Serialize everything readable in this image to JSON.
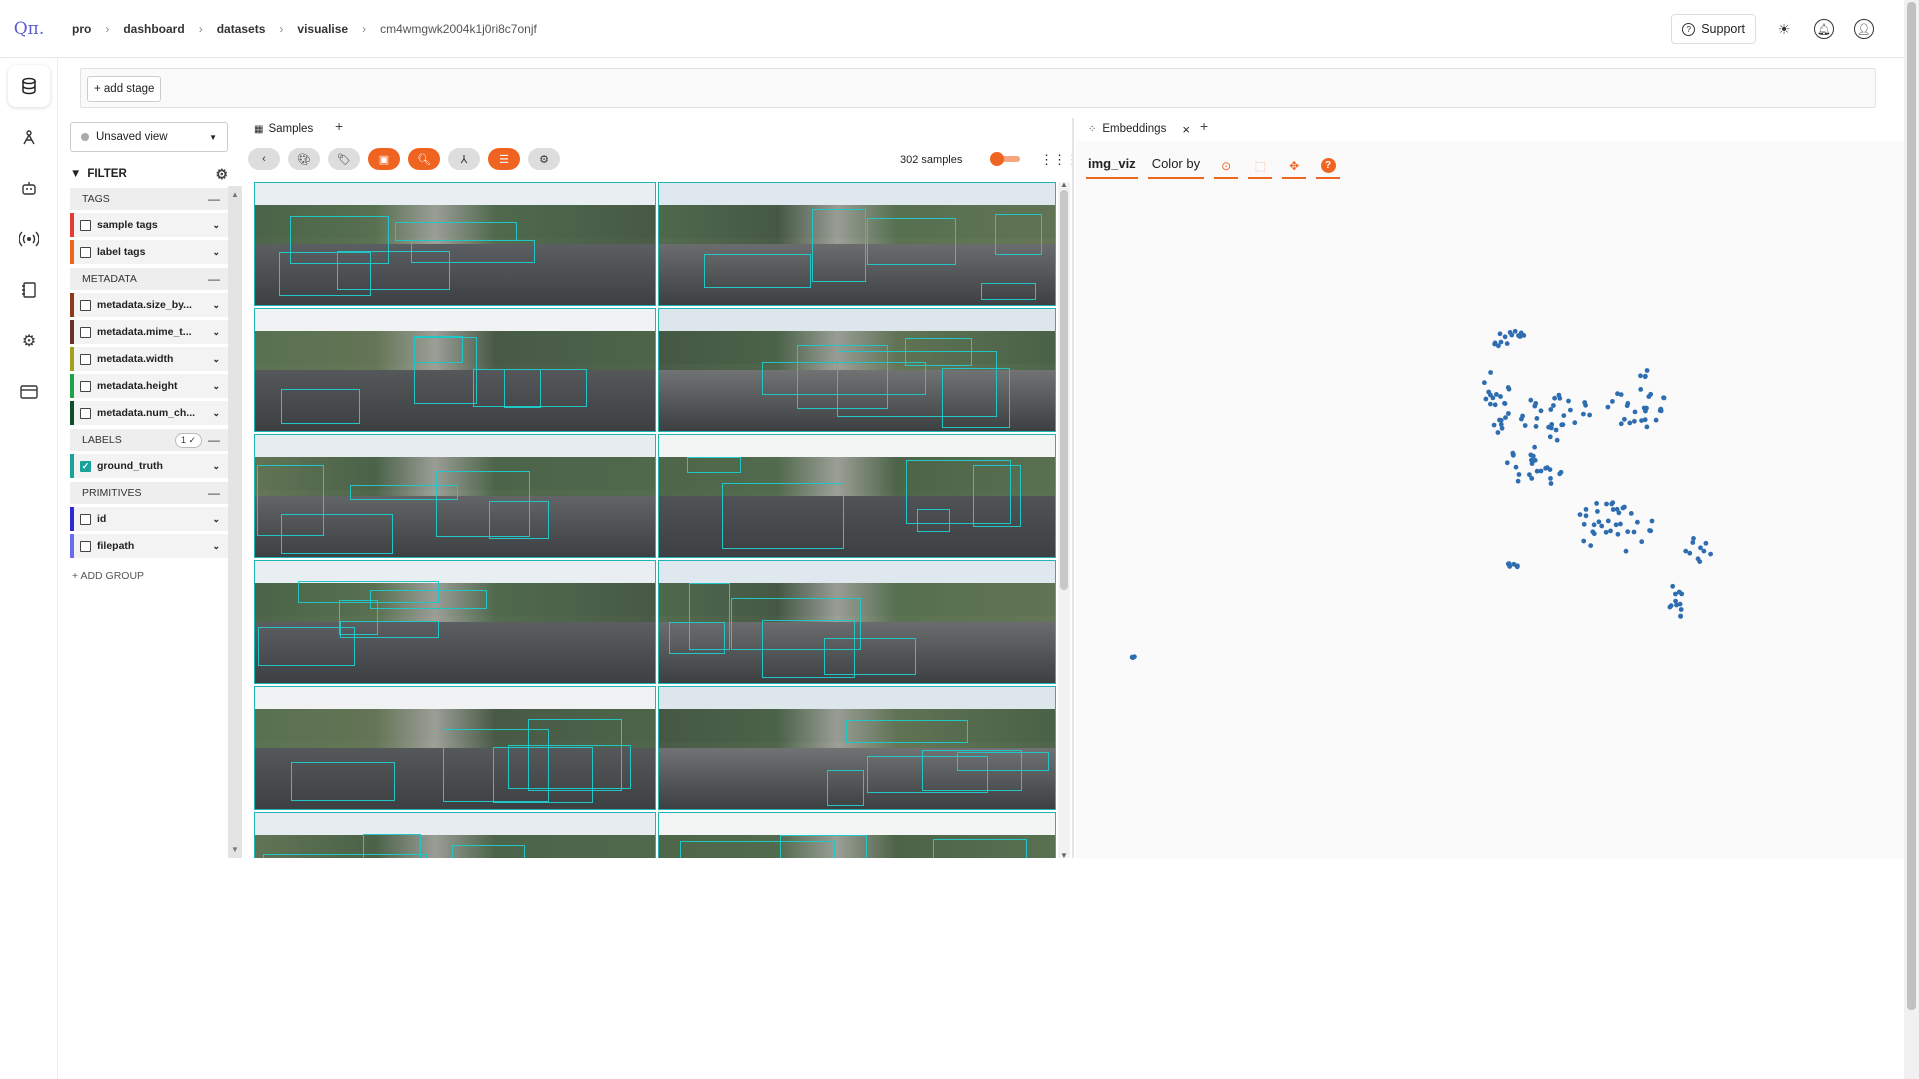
{
  "app": {
    "logo": "Qπ."
  },
  "breadcrumbs": [
    "pro",
    "dashboard",
    "datasets",
    "visualise",
    "cm4wmgwk2004k1j0ri8c7onjf"
  ],
  "topbar": {
    "support_label": "Support"
  },
  "stage_bar": {
    "add_stage_label": "+ add stage"
  },
  "sidebar": {
    "view_select": "Unsaved view",
    "filter_label": "FILTER",
    "groups": [
      {
        "name": "TAGS",
        "items": [
          {
            "label": "sample tags",
            "color": "#e53935"
          },
          {
            "label": "label tags",
            "color": "#f06422"
          }
        ]
      },
      {
        "name": "METADATA",
        "items": [
          {
            "label": "metadata.size_by...",
            "color": "#8b3a1d"
          },
          {
            "label": "metadata.mime_t...",
            "color": "#6b2e2e"
          },
          {
            "label": "metadata.width",
            "color": "#a1a21c"
          },
          {
            "label": "metadata.height",
            "color": "#1fa34a"
          },
          {
            "label": "metadata.num_ch...",
            "color": "#114d26"
          }
        ]
      },
      {
        "name": "LABELS",
        "badge": "1 ✓",
        "items": [
          {
            "label": "ground_truth",
            "color": "#1aa39b",
            "checked": true
          }
        ]
      },
      {
        "name": "PRIMITIVES",
        "items": [
          {
            "label": "id",
            "color": "#2b2bd6"
          },
          {
            "label": "filepath",
            "color": "#6b6bf0"
          }
        ]
      }
    ],
    "add_group_label": "+ ADD GROUP"
  },
  "samples": {
    "tab_label": "Samples",
    "count_label": "302 samples",
    "tools": [
      "back",
      "palette",
      "tag",
      "patches",
      "search",
      "person",
      "list",
      "settings"
    ]
  },
  "embeddings": {
    "tab_label": "Embeddings",
    "selector": "img_viz",
    "color_by": "Color by",
    "point_color": "#2e6db0"
  },
  "colors": {
    "accent": "#f06422",
    "bbox": "#22c6c6"
  }
}
